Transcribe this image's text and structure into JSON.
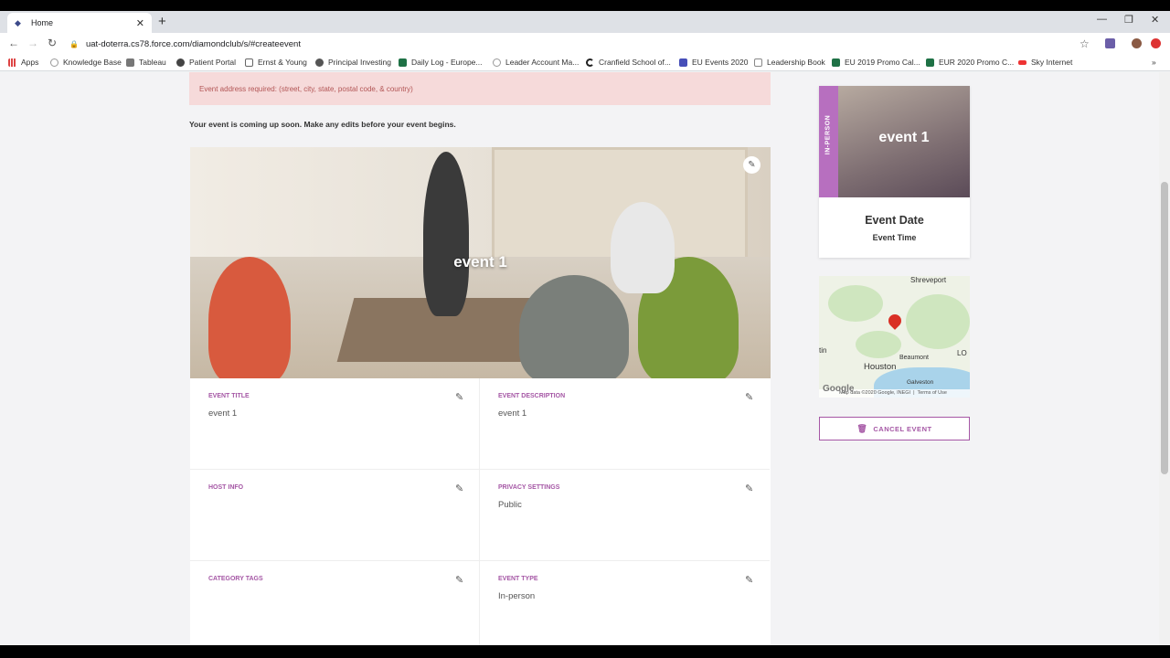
{
  "browser": {
    "tab_title": "Home",
    "url": "uat-doterra.cs78.force.com/diamondclub/s/#createevent"
  },
  "bookmarks": [
    {
      "label": "Apps",
      "color": "#d44"
    },
    {
      "label": "Knowledge Base",
      "color": "#999"
    },
    {
      "label": "Tableau",
      "color": "#777"
    },
    {
      "label": "Patient Portal",
      "color": "#444"
    },
    {
      "label": "Ernst & Young",
      "color": "#666"
    },
    {
      "label": "Principal Investing",
      "color": "#555"
    },
    {
      "label": "Daily Log - Europe...",
      "color": "#1e7145"
    },
    {
      "label": "Leader Account Ma...",
      "color": "#999"
    },
    {
      "label": "Cranfield School of...",
      "color": "#222"
    },
    {
      "label": "EU Events 2020",
      "color": "#464eb8"
    },
    {
      "label": "Leadership Book",
      "color": "#888"
    },
    {
      "label": "EU 2019 Promo Cal...",
      "color": "#1e7145"
    },
    {
      "label": "EUR 2020 Promo C...",
      "color": "#1e7145"
    },
    {
      "label": "Sky Internet",
      "color": "#e33"
    }
  ],
  "page": {
    "alert": "Event address required: (street, city, state, postal code, & country)",
    "soon_message": "Your event is coming up soon. Make any edits before your event begins.",
    "hero_title": "event 1",
    "fields": [
      {
        "label": "Event Title",
        "value": "event 1"
      },
      {
        "label": "Event Description",
        "value": "event 1"
      },
      {
        "label": "Host Info",
        "value": ""
      },
      {
        "label": "Privacy Settings",
        "value": "Public"
      },
      {
        "label": "Category Tags",
        "value": ""
      },
      {
        "label": "Event Type",
        "value": "In-person"
      }
    ]
  },
  "sidebar": {
    "badge": "IN-PERSON",
    "card_title": "event 1",
    "event_date": "Event Date",
    "event_time": "Event Time",
    "map": {
      "places": [
        "Shreveport",
        "Houston",
        "Beaumont",
        "Galveston",
        "tin",
        "LO"
      ],
      "attribution": "Map data ©2020 Google, INEGI",
      "terms": "Terms of Use",
      "logo": "Google"
    },
    "cancel_label": "CANCEL EVENT"
  }
}
